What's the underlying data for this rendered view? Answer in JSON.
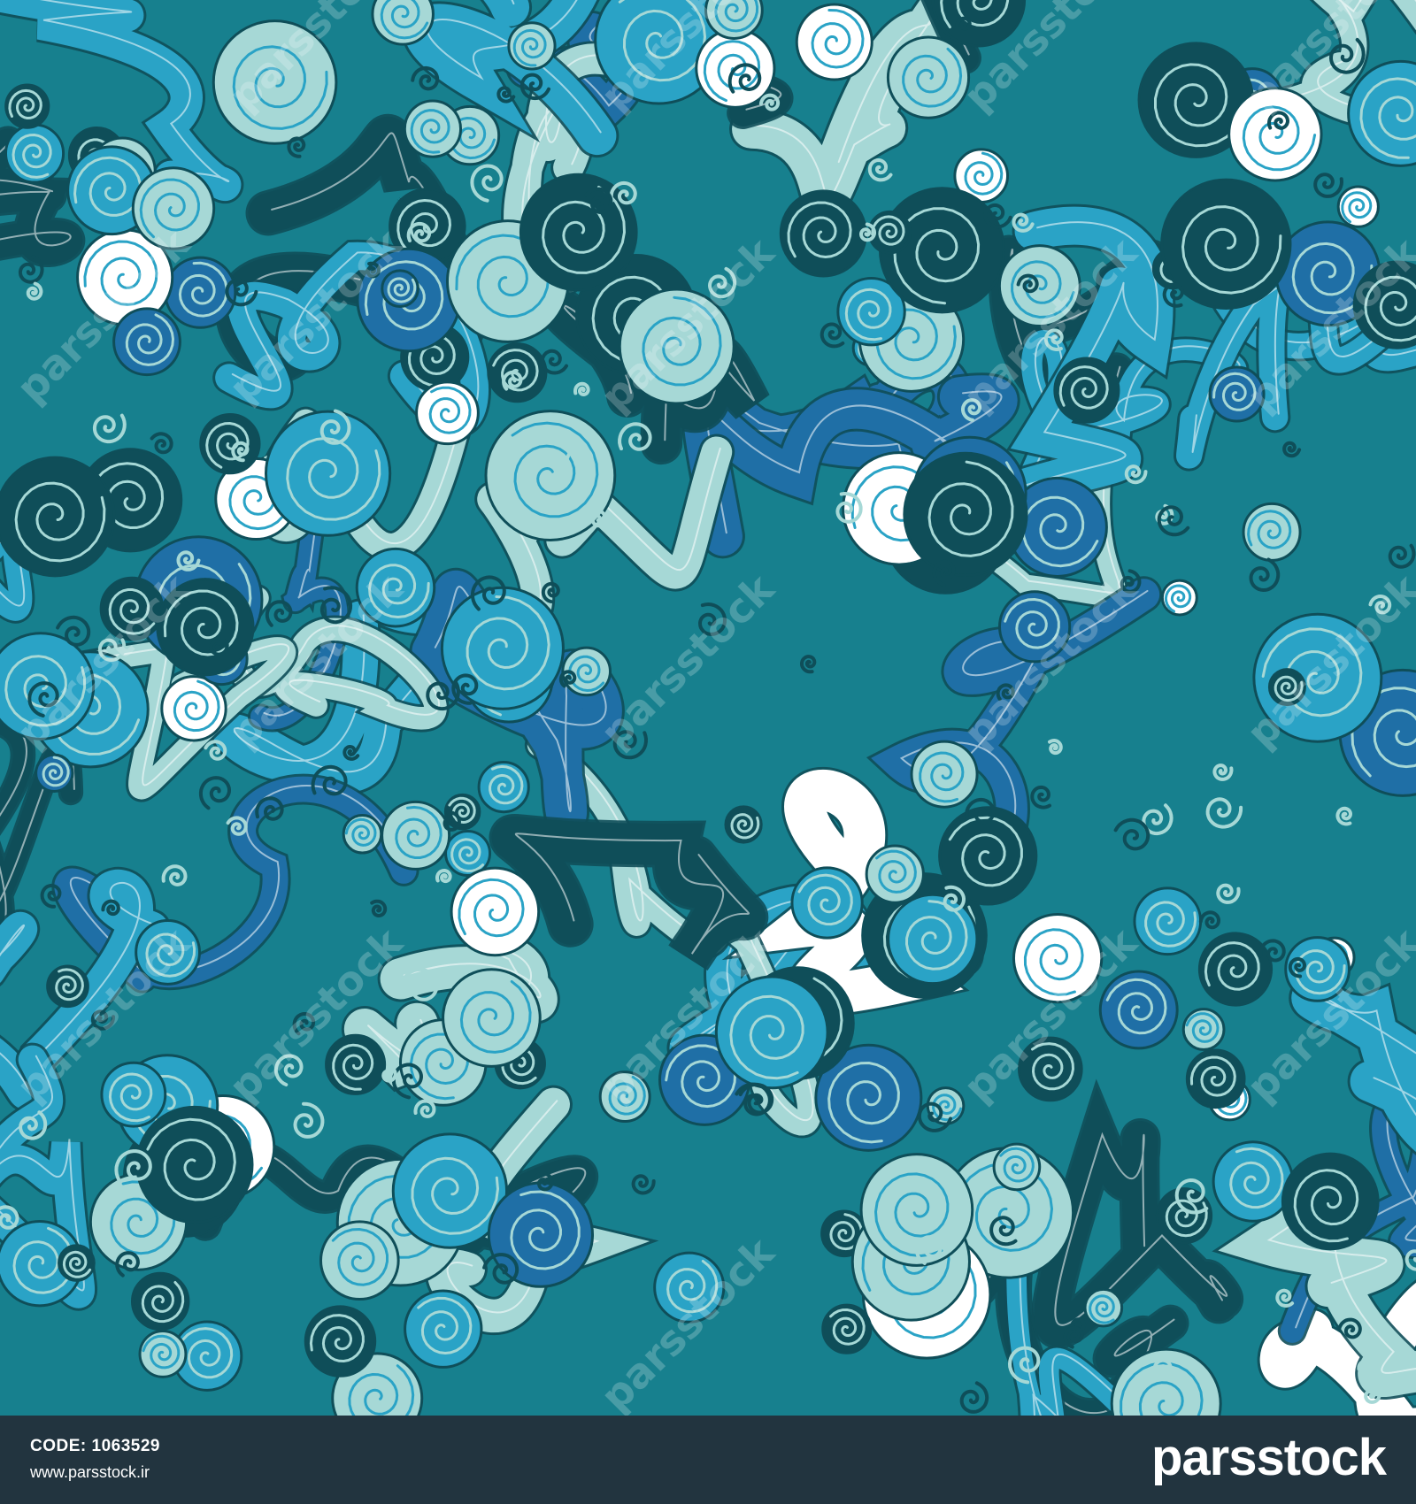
{
  "footer": {
    "code_label": "CODE: 1063529",
    "website": "www.parsstock.ir",
    "brand": "parsstock"
  },
  "watermark": {
    "text": "parsstock"
  },
  "colors": {
    "background": "#17808e",
    "dark_teal": "#0f4e59",
    "deep_blue": "#1f6fa6",
    "bright_blue": "#2aa3c6",
    "light_aqua": "#a6d8d6",
    "white": "#ffffff",
    "footer": "#22343f"
  }
}
